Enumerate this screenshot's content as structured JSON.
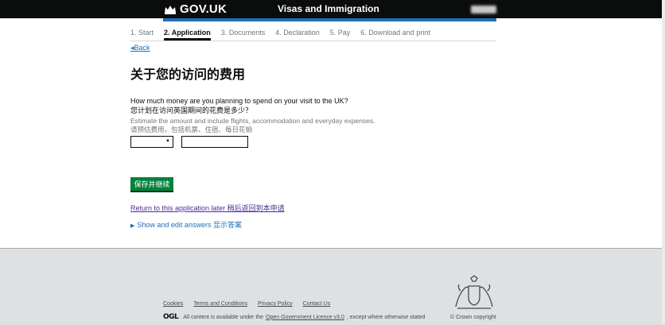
{
  "header": {
    "logo_text": "GOV.UK",
    "service_name": "Visas and Immigration"
  },
  "steps": [
    {
      "label": "1. Start",
      "active": false
    },
    {
      "label": "2. Application",
      "active": true
    },
    {
      "label": "3. Documents",
      "active": false
    },
    {
      "label": "4. Declaration",
      "active": false
    },
    {
      "label": "5. Pay",
      "active": false
    },
    {
      "label": "6. Download and print",
      "active": false
    }
  ],
  "back_link": "Back",
  "page_title": "关于您的访问的费用",
  "question": {
    "label_en": "How much money are you planning to spend on your visit to the UK?",
    "label_zh": "您计划在访问英国期间的花费是多少？",
    "hint_en": "Estimate the amount and include flights, accommodation and everyday expenses.",
    "hint_zh": "请预估费用，包括机票、住宿、每日花销",
    "currency_value": "",
    "amount_value": ""
  },
  "save_button": "保存并继续",
  "return_link": "Return to this application later 稍后返回到本申请",
  "show_edit": "Show and edit answers 显示答案",
  "footer": {
    "links": [
      "Cookies",
      "Terms and Conditions",
      "Privacy Policy",
      "Contact Us"
    ],
    "ogl_logo": "OGL",
    "licence_prefix": "All content is available under the",
    "licence_link": "Open Government Licence v3.0",
    "licence_suffix": ", except where otherwise stated",
    "copyright": "© Crown copyright"
  },
  "colors": {
    "header_bg": "#0b0c0c",
    "accent_blue": "#1d70b8",
    "button_green": "#00823b",
    "footer_bg": "#dee0e2"
  }
}
